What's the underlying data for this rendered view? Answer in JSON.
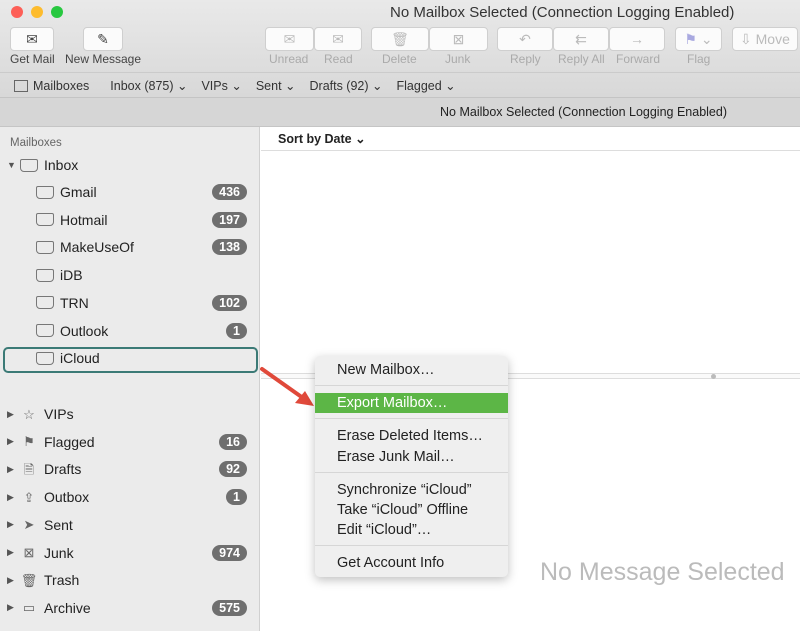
{
  "window": {
    "title": "No Mailbox Selected (Connection Logging Enabled)"
  },
  "toolbar": {
    "get_mail": "Get Mail",
    "new_message": "New Message",
    "unread": "Unread",
    "read": "Read",
    "delete": "Delete",
    "junk": "Junk",
    "reply": "Reply",
    "reply_all": "Reply All",
    "forward": "Forward",
    "flag": "Flag",
    "move": "Move"
  },
  "favorites": {
    "mailboxes": "Mailboxes",
    "inbox": "Inbox (875) ⌄",
    "vips": "VIPs ⌄",
    "sent": "Sent ⌄",
    "drafts": "Drafts (92) ⌄",
    "flagged": "Flagged ⌄"
  },
  "subheader": "No Mailbox Selected (Connection Logging Enabled)",
  "sidebar": {
    "header": "Mailboxes",
    "inbox": "Inbox",
    "accounts": [
      {
        "name": "Gmail",
        "count": "436"
      },
      {
        "name": "Hotmail",
        "count": "197"
      },
      {
        "name": "MakeUseOf",
        "count": "138"
      },
      {
        "name": "iDB",
        "count": ""
      },
      {
        "name": "TRN",
        "count": "102"
      },
      {
        "name": "Outlook",
        "count": "1"
      },
      {
        "name": "iCloud",
        "count": ""
      }
    ],
    "folders": [
      {
        "name": "VIPs",
        "count": ""
      },
      {
        "name": "Flagged",
        "count": "16"
      },
      {
        "name": "Drafts",
        "count": "92"
      },
      {
        "name": "Outbox",
        "count": "1"
      },
      {
        "name": "Sent",
        "count": ""
      },
      {
        "name": "Junk",
        "count": "974"
      },
      {
        "name": "Trash",
        "count": ""
      },
      {
        "name": "Archive",
        "count": "575"
      }
    ]
  },
  "list": {
    "sort": "Sort by Date ⌄"
  },
  "viewer": {
    "empty": "No Message Selected"
  },
  "context_menu": {
    "items": [
      "New Mailbox…",
      "Export Mailbox…",
      "Erase Deleted Items…",
      "Erase Junk Mail…",
      "Synchronize “iCloud”",
      "Take “iCloud” Offline",
      "Edit “iCloud”…",
      "Get Account Info"
    ]
  },
  "colors": {
    "highlight": "#5cb646",
    "arrow": "#e0493a",
    "selection": "#3b7a76"
  }
}
